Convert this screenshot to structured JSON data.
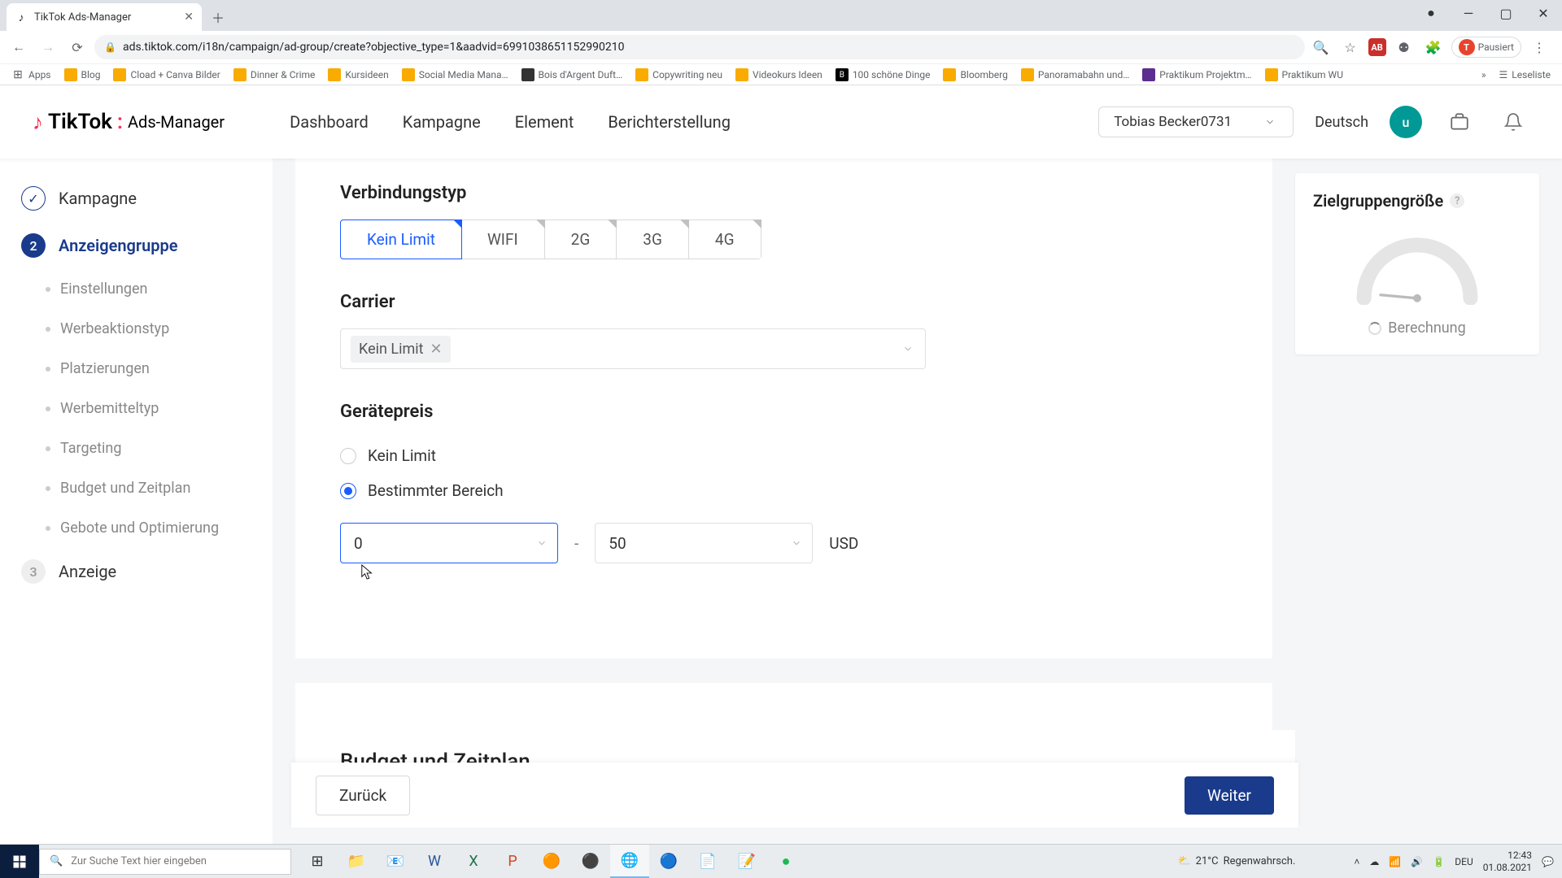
{
  "browser": {
    "tab_title": "TikTok Ads-Manager",
    "url": "ads.tiktok.com/i18n/campaign/ad-group/create?objective_type=1&aadvid=6991038651152990210",
    "pause_label": "Pausiert",
    "bookmarks": [
      "Apps",
      "Blog",
      "Cload + Canva Bilder",
      "Dinner & Crime",
      "Kursideen",
      "Social Media Mana…",
      "Bois d'Argent Duft…",
      "Copywriting neu",
      "Videokurs Ideen",
      "100 schöne Dinge",
      "Bloomberg",
      "Panoramabahn und…",
      "Praktikum Projektm…",
      "Praktikum WU"
    ],
    "reading_list": "Leseliste"
  },
  "header": {
    "logo_main": "TikTok",
    "logo_sub": "Ads-Manager",
    "nav": [
      "Dashboard",
      "Kampagne",
      "Element",
      "Berichterstellung"
    ],
    "account": "Tobias Becker0731",
    "language": "Deutsch",
    "avatar_letter": "u"
  },
  "sidebar": {
    "steps": [
      {
        "label": "Kampagne",
        "state": "done"
      },
      {
        "label": "Anzeigengruppe",
        "state": "active",
        "num": "2"
      },
      {
        "label": "Anzeige",
        "state": "pending",
        "num": "3"
      }
    ],
    "substeps": [
      "Einstellungen",
      "Werbeaktionstyp",
      "Platzierungen",
      "Werbemitteltyp",
      "Targeting",
      "Budget und Zeitplan",
      "Gebote und Optimierung"
    ]
  },
  "form": {
    "connection": {
      "title": "Verbindungstyp",
      "options": [
        "Kein Limit",
        "WIFI",
        "2G",
        "3G",
        "4G"
      ],
      "selected_index": 0
    },
    "carrier": {
      "title": "Carrier",
      "chip": "Kein Limit"
    },
    "device_price": {
      "title": "Gerätepreis",
      "radio_nolimit": "Kein Limit",
      "radio_range": "Bestimmter Bereich",
      "from": "0",
      "to": "50",
      "currency": "USD"
    },
    "next_section_title": "Budget und Zeitplan"
  },
  "sidepanel": {
    "title": "Zielgruppengröße",
    "status": "Berechnung"
  },
  "footer": {
    "back": "Zurück",
    "next": "Weiter"
  },
  "taskbar": {
    "search_placeholder": "Zur Suche Text hier eingeben",
    "weather_temp": "21°C",
    "weather_text": "Regenwahrsch.",
    "lang": "DEU",
    "time": "12:43",
    "date": "01.08.2021"
  }
}
